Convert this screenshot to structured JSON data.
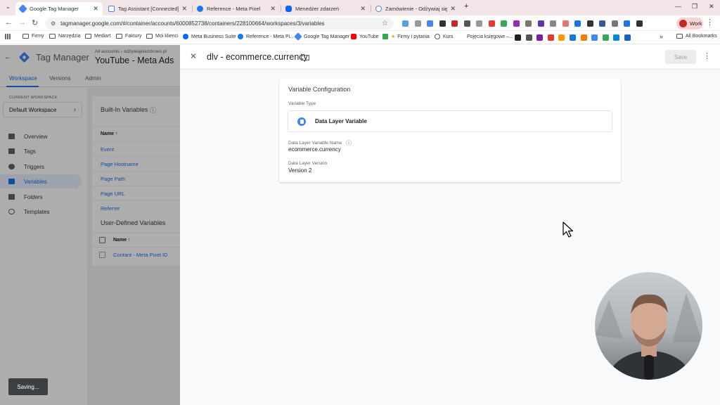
{
  "browser": {
    "tabs": [
      {
        "label": "Google Tag Manager",
        "active": true,
        "close": "✕"
      },
      {
        "label": "Tag Assistant [Connected]",
        "close": "✕"
      },
      {
        "label": "Reference - Meta Pixel",
        "close": "✕"
      },
      {
        "label": "Menedżer zdarzeń",
        "close": "✕"
      },
      {
        "label": "Zamówienie - Odżywiaj się zdr",
        "close": "✕"
      }
    ],
    "new_tab": "+",
    "window_controls": {
      "minimize": "—",
      "restore": "❐",
      "close": "✕"
    },
    "url": "tagmanager.google.com/#/container/accounts/6000852738/containers/228100664/workspaces/3/variables",
    "profile_label": "Work",
    "bookmarks": [
      "Firmy",
      "Narzędzia",
      "Mediart",
      "Faktury",
      "Moi klienci",
      "Meta Business Suite",
      "Reference - Meta Pi...",
      "Google Tag Manager",
      "YouTube",
      "Firmy i pytania",
      "Kurs",
      "Pojęcia księgowe –..."
    ],
    "bookmarks_overflow": "»",
    "all_bookmarks": "All Bookmarks"
  },
  "gtm": {
    "app_title": "Tag Manager",
    "breadcrumb": "All accounts › odżywiajsiezdrowo.pl",
    "container_name": "YouTube - Meta Ads",
    "tabs": [
      "Workspace",
      "Versions",
      "Admin"
    ],
    "current_workspace_label": "CURRENT WORKSPACE",
    "workspace_name": "Default Workspace",
    "nav": [
      "Overview",
      "Tags",
      "Triggers",
      "Variables",
      "Folders",
      "Templates"
    ],
    "builtin_title": "Built-In Variables",
    "name_col": "Name ↑",
    "builtin_vars": [
      "Event",
      "Page Hostname",
      "Page Path",
      "Page URL",
      "Referrer"
    ],
    "userdef_title": "User-Defined Variables",
    "userdef_vars": [
      "Contant - Meta Pixel ID"
    ]
  },
  "panel": {
    "title": "dlv - ecommerce.currency",
    "save_label": "Save",
    "card_title": "Variable Configuration",
    "type_label": "Variable Type",
    "type_name": "Data Layer Variable",
    "dlv_name_label": "Data Layer Variable Name",
    "dlv_name_value": "ecommerce.currency",
    "version_label": "Data Layer Version",
    "version_value": "Version 2"
  },
  "toast": "Saving...",
  "colors": {
    "accent": "#1a73e8",
    "tabstrip": "#f1e5e8"
  }
}
